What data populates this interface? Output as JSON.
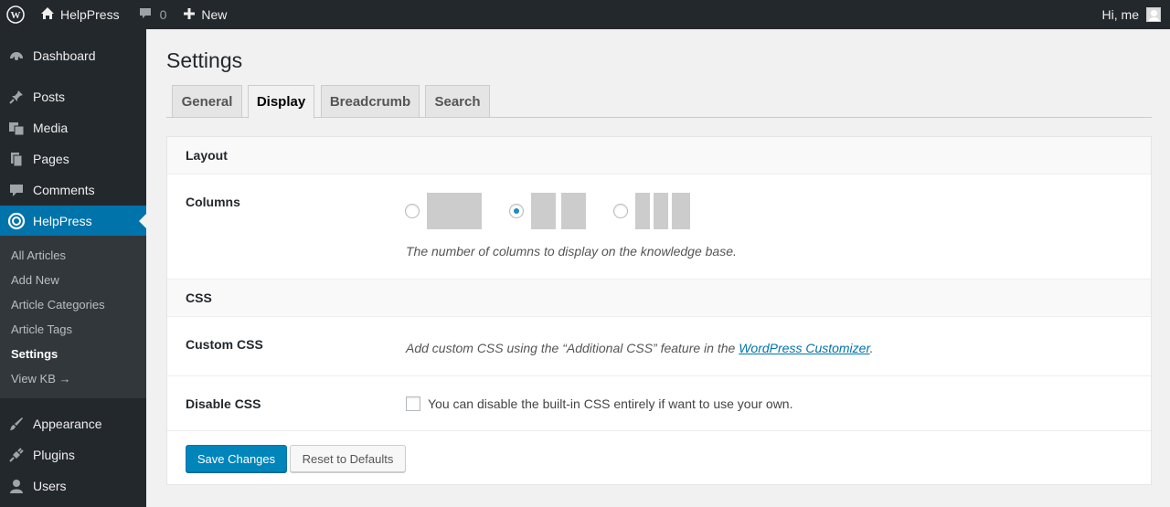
{
  "admin_bar": {
    "site_name": "HelpPress",
    "comments_count": "0",
    "new_label": "New",
    "greeting": "Hi, me"
  },
  "sidebar": {
    "items_top": [
      {
        "label": "Dashboard",
        "icon": "dashboard-icon"
      },
      {
        "label": "Posts",
        "icon": "pin-icon"
      },
      {
        "label": "Media",
        "icon": "media-icon"
      },
      {
        "label": "Pages",
        "icon": "pages-icon"
      },
      {
        "label": "Comments",
        "icon": "comment-icon"
      },
      {
        "label": "HelpPress",
        "icon": "lifebuoy-icon"
      }
    ],
    "submenu": [
      "All Articles",
      "Add New",
      "Article Categories",
      "Article Tags",
      "Settings",
      "View KB →"
    ],
    "items_bottom": [
      {
        "label": "Appearance",
        "icon": "brush-icon"
      },
      {
        "label": "Plugins",
        "icon": "plug-icon"
      },
      {
        "label": "Users",
        "icon": "user-icon"
      }
    ]
  },
  "page": {
    "title": "Settings",
    "tabs": [
      "General",
      "Display",
      "Breadcrumb",
      "Search"
    ],
    "active_tab": "Display"
  },
  "layout_section": {
    "heading": "Layout",
    "columns_label": "Columns",
    "columns_options": [
      1,
      2,
      3
    ],
    "columns_selected": 2,
    "columns_description": "The number of columns to display on the knowledge base."
  },
  "css_section": {
    "heading": "CSS",
    "custom_css_label": "Custom CSS",
    "custom_css_text_before": "Add custom CSS using the “Additional CSS” feature in the ",
    "custom_css_link": "WordPress Customizer",
    "custom_css_text_after": ".",
    "disable_css_label": "Disable CSS",
    "disable_css_text": "You can disable the built-in CSS entirely if want to use your own.",
    "disable_css_checked": false
  },
  "buttons": {
    "save": "Save Changes",
    "reset": "Reset to Defaults"
  },
  "colors": {
    "accent": "#0073aa",
    "primary_button": "#0085ba",
    "admin_dark": "#23282d"
  }
}
